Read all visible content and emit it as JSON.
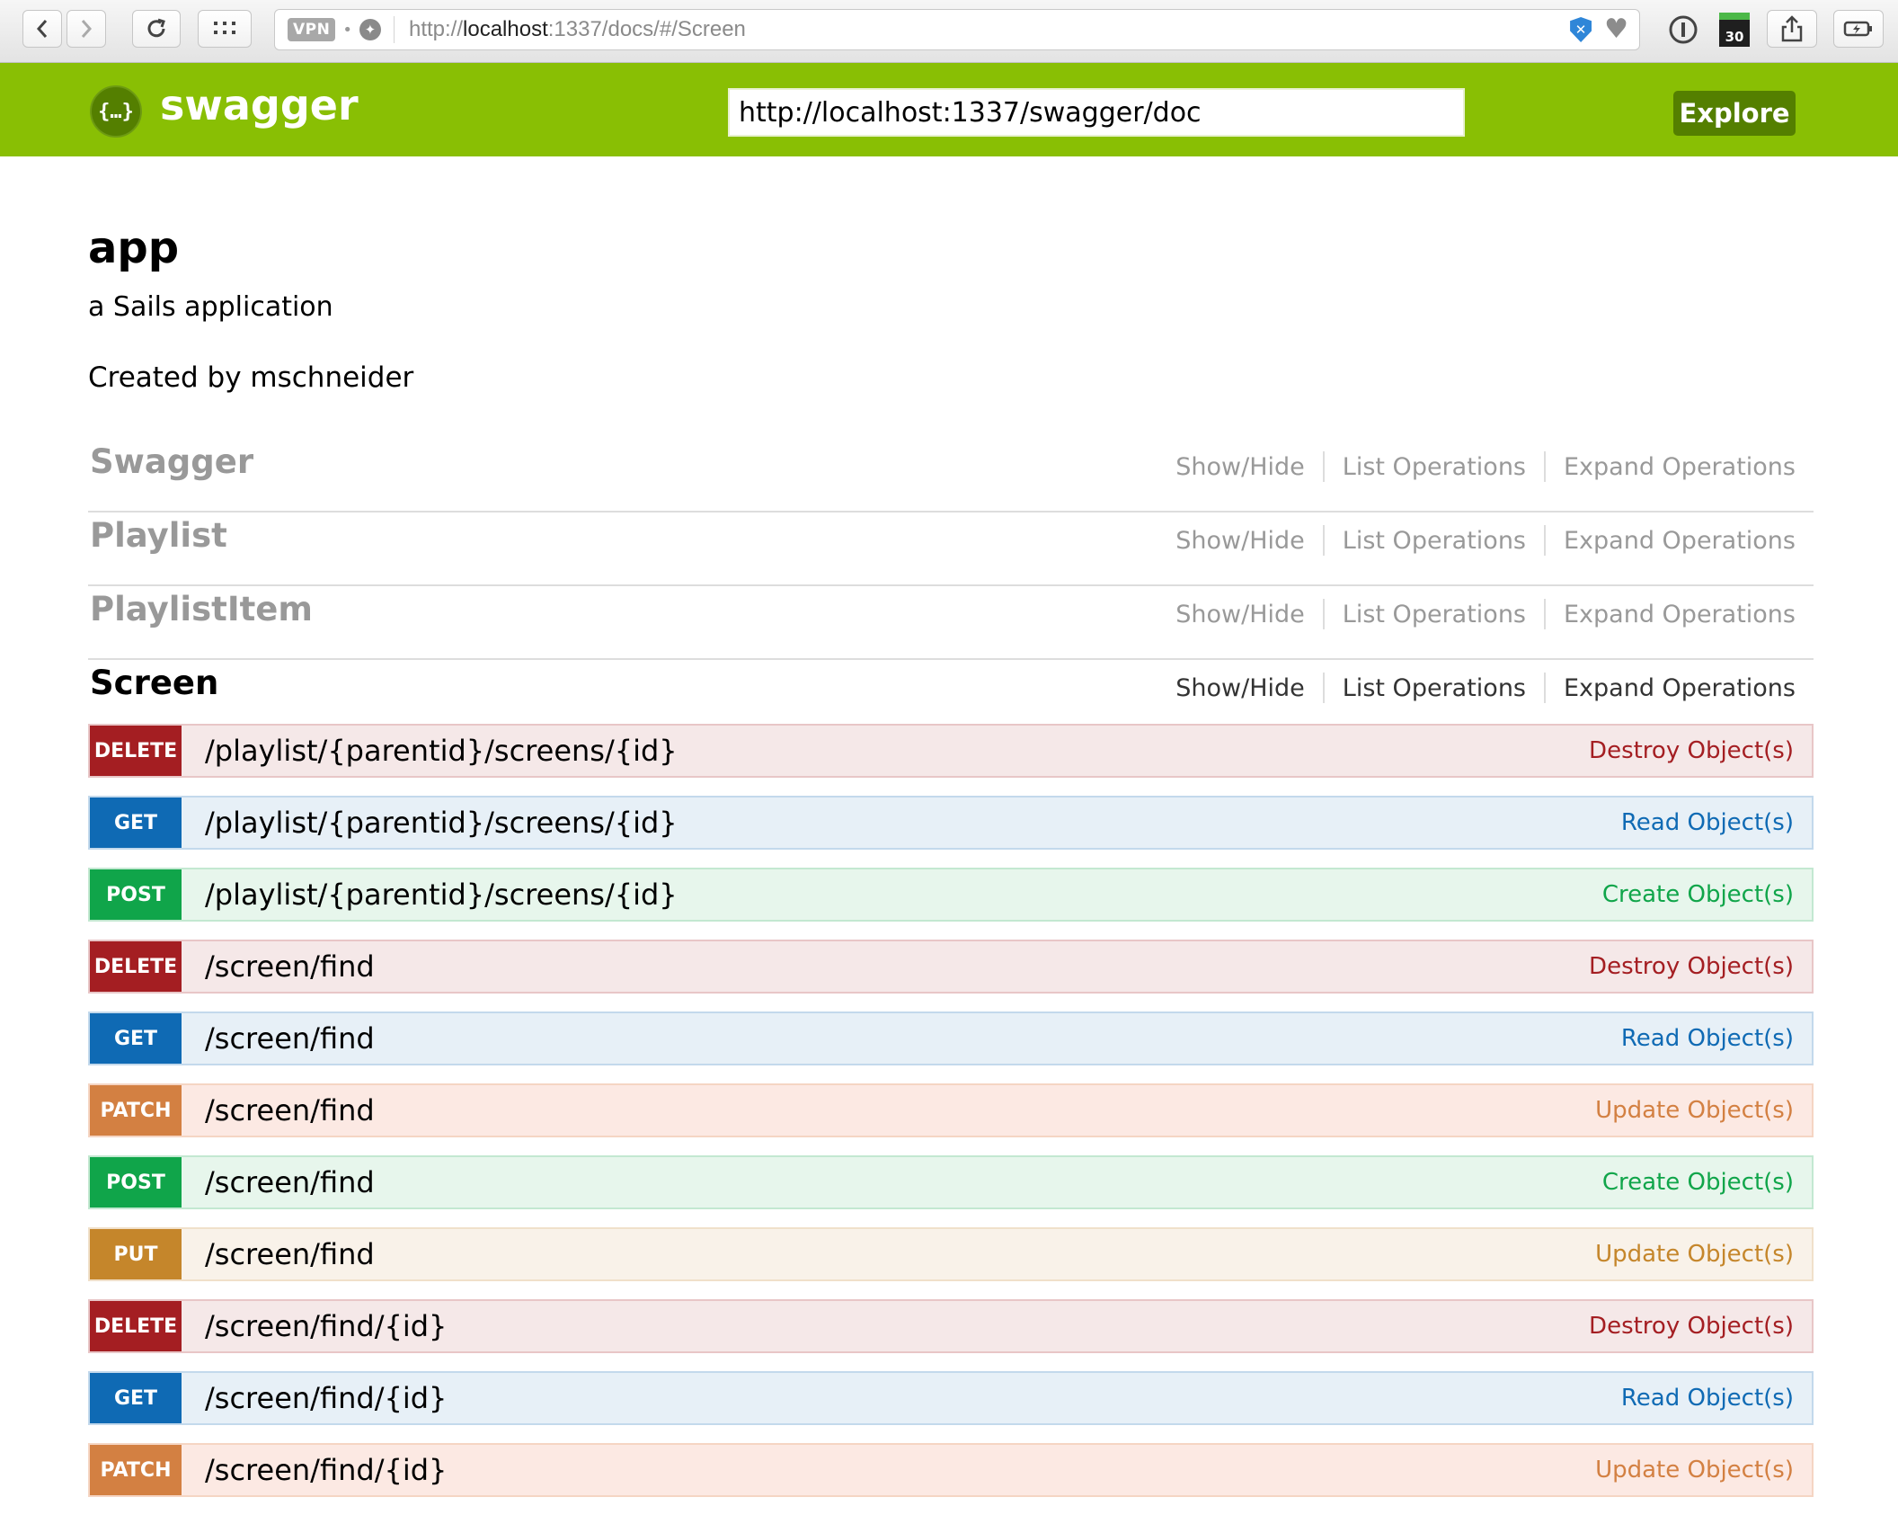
{
  "browser": {
    "vpn_label": "VPN",
    "url_prefix": "http://",
    "url_host": "localhost",
    "url_rest": ":1337/docs/#/Screen",
    "badge_count": "30"
  },
  "header": {
    "logo_glyph": "{…}",
    "title": "swagger",
    "spec_url": "http://localhost:1337/swagger/doc",
    "explore_label": "Explore",
    "brand_color": "#89bf04"
  },
  "info": {
    "title": "app",
    "description": "a Sails application",
    "contact": "Created by mschneider"
  },
  "resources": [
    {
      "name": "Swagger",
      "show_hide": "Show/Hide",
      "list_ops": "List Operations",
      "expand_ops": "Expand Operations"
    },
    {
      "name": "Playlist",
      "show_hide": "Show/Hide",
      "list_ops": "List Operations",
      "expand_ops": "Expand Operations"
    },
    {
      "name": "PlaylistItem",
      "show_hide": "Show/Hide",
      "list_ops": "List Operations",
      "expand_ops": "Expand Operations"
    },
    {
      "name": "Screen",
      "show_hide": "Show/Hide",
      "list_ops": "List Operations",
      "expand_ops": "Expand Operations"
    }
  ],
  "operations": [
    {
      "method": "DELETE",
      "path": "/playlist/{parentid}/screens/{id}",
      "summary": "Destroy Object(s)"
    },
    {
      "method": "GET",
      "path": "/playlist/{parentid}/screens/{id}",
      "summary": "Read Object(s)"
    },
    {
      "method": "POST",
      "path": "/playlist/{parentid}/screens/{id}",
      "summary": "Create Object(s)"
    },
    {
      "method": "DELETE",
      "path": "/screen/find",
      "summary": "Destroy Object(s)"
    },
    {
      "method": "GET",
      "path": "/screen/find",
      "summary": "Read Object(s)"
    },
    {
      "method": "PATCH",
      "path": "/screen/find",
      "summary": "Update Object(s)"
    },
    {
      "method": "POST",
      "path": "/screen/find",
      "summary": "Create Object(s)"
    },
    {
      "method": "PUT",
      "path": "/screen/find",
      "summary": "Update Object(s)"
    },
    {
      "method": "DELETE",
      "path": "/screen/find/{id}",
      "summary": "Destroy Object(s)"
    },
    {
      "method": "GET",
      "path": "/screen/find/{id}",
      "summary": "Read Object(s)"
    },
    {
      "method": "PATCH",
      "path": "/screen/find/{id}",
      "summary": "Update Object(s)"
    }
  ],
  "method_colors": {
    "DELETE": "#a41e22",
    "GET": "#0f6ab4",
    "POST": "#10a54a",
    "PATCH": "#d38042",
    "PUT": "#c5862b"
  }
}
